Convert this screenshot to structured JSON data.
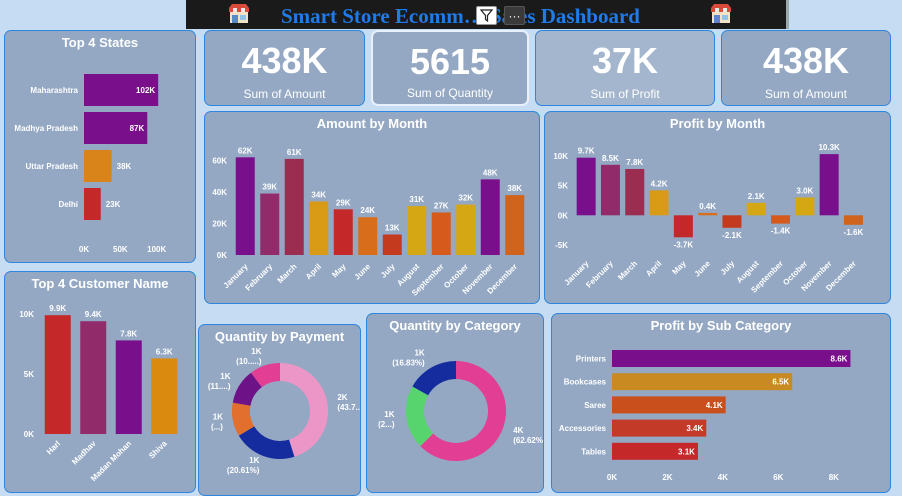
{
  "header": {
    "title": "Smart Store Ecomm… Sales Dashboard",
    "more_label": "···"
  },
  "kpis": [
    {
      "value": "438K",
      "label": "Sum of Amount"
    },
    {
      "value": "5615",
      "label": "Sum of Quantity"
    },
    {
      "value": "37K",
      "label": "Sum of Profit"
    },
    {
      "value": "438K",
      "label": "Sum of Amount"
    }
  ],
  "panels": {
    "states": "Top 4 States",
    "customers": "Top 4 Customer Name",
    "amount_month": "Amount by Month",
    "profit_month": "Profit by Month",
    "payment": "Quantity by Payment",
    "category": "Quantity by Category",
    "subcategory": "Profit by Sub Category"
  },
  "colors": {
    "purple": "#7a0f8c",
    "plum": "#922b6a",
    "wine": "#9a2d50",
    "mustard": "#d99a15",
    "red": "#c42828",
    "orange": "#d86e1c",
    "gold": "#d6a714",
    "pink": "#e23e94",
    "navy": "#142c9e",
    "green": "#58d46e"
  },
  "chart_data": [
    {
      "id": "states",
      "type": "bar",
      "orientation": "horizontal",
      "title": "Top 4 States",
      "categories": [
        "Maharashtra",
        "Madhya Pradesh",
        "Uttar Pradesh",
        "Delhi"
      ],
      "values": [
        102000,
        87000,
        38000,
        23000
      ],
      "labels": [
        "102K",
        "87K",
        "38K",
        "23K"
      ],
      "colors": [
        "#7a0f8c",
        "#7a0f8c",
        "#d9841b",
        "#c42828"
      ],
      "xticks": [
        "0K",
        "50K",
        "100K"
      ],
      "xlim": [
        0,
        110000
      ]
    },
    {
      "id": "customers",
      "type": "bar",
      "title": "Top 4 Customer Name",
      "categories": [
        "Harl",
        "Madhav",
        "Madan Mohan",
        "Shiva"
      ],
      "values": [
        9900,
        9400,
        7800,
        6300
      ],
      "labels": [
        "9.9K",
        "9.4K",
        "7.8K",
        "6.3K"
      ],
      "colors": [
        "#c42828",
        "#922b6a",
        "#7a0f8c",
        "#d98a0f"
      ],
      "yticks": [
        "0K",
        "5K",
        "10K"
      ],
      "ylim": [
        0,
        10000
      ]
    },
    {
      "id": "amount_month",
      "type": "bar",
      "title": "Amount by Month",
      "categories": [
        "January",
        "February",
        "March",
        "April",
        "May",
        "June",
        "July",
        "August",
        "September",
        "October",
        "November",
        "December"
      ],
      "values": [
        62000,
        39000,
        61000,
        34000,
        29000,
        24000,
        13000,
        31000,
        27000,
        32000,
        48000,
        38000
      ],
      "labels": [
        "62K",
        "39K",
        "61K",
        "34K",
        "29K",
        "24K",
        "13K",
        "31K",
        "27K",
        "32K",
        "48K",
        "38K"
      ],
      "colors": [
        "#7a0f8c",
        "#922b6a",
        "#9a2d50",
        "#d99a15",
        "#c42828",
        "#d86e1c",
        "#c43a1e",
        "#d6a714",
        "#d65a1c",
        "#d6a714",
        "#7a0f8c",
        "#d0641c"
      ],
      "yticks": [
        "0K",
        "20K",
        "40K",
        "60K"
      ],
      "ylim": [
        0,
        66000
      ]
    },
    {
      "id": "profit_month",
      "type": "bar",
      "title": "Profit by Month",
      "categories": [
        "January",
        "February",
        "March",
        "April",
        "May",
        "June",
        "July",
        "August",
        "September",
        "October",
        "November",
        "December"
      ],
      "values": [
        9700,
        8500,
        7800,
        4200,
        -3700,
        400,
        -2100,
        2100,
        -1400,
        3000,
        10300,
        -1600
      ],
      "labels": [
        "9.7K",
        "8.5K",
        "7.8K",
        "4.2K",
        "-3.7K",
        "0.4K",
        "-2.1K",
        "2.1K",
        "-1.4K",
        "3.0K",
        "10.3K",
        "-1.6K"
      ],
      "colors": [
        "#7a0f8c",
        "#922b6a",
        "#9a2d50",
        "#d99a15",
        "#c42828",
        "#d86e1c",
        "#c43a1e",
        "#d6a714",
        "#d65a1c",
        "#d6a714",
        "#7a0f8c",
        "#d0641c"
      ],
      "yticks": [
        "-5K",
        "0K",
        "5K",
        "10K"
      ],
      "ylim": [
        -5000,
        11500
      ]
    },
    {
      "id": "payment",
      "type": "pie",
      "title": "Quantity by Payment",
      "slices": [
        {
          "label": "2K (43.7...)",
          "value": 43.7,
          "color": "#ec96c8"
        },
        {
          "label": "1K (20.61%)",
          "value": 20.61,
          "color": "#142c9e"
        },
        {
          "label": "1K (...)",
          "value": 11,
          "color": "#e26f2e"
        },
        {
          "label": "1K (11....)",
          "value": 11.5,
          "color": "#6e1288"
        },
        {
          "label": "1K (10.....)",
          "value": 10,
          "color": "#e23e94"
        }
      ]
    },
    {
      "id": "category",
      "type": "pie",
      "title": "Quantity by Category",
      "slices": [
        {
          "label": "4K (62.62%)",
          "value": 62.62,
          "color": "#e23e94"
        },
        {
          "label": "1K (2...)",
          "value": 20.55,
          "color": "#58d46e"
        },
        {
          "label": "1K (16.83%)",
          "value": 16.83,
          "color": "#142c9e"
        }
      ]
    },
    {
      "id": "subcategory",
      "type": "bar",
      "orientation": "horizontal",
      "title": "Profit by Sub Category",
      "categories": [
        "Printers",
        "Bookcases",
        "Saree",
        "Accessories",
        "Tables"
      ],
      "values": [
        8600,
        6500,
        4100,
        3400,
        3100
      ],
      "labels": [
        "8.6K",
        "6.5K",
        "4.1K",
        "3.4K",
        "3.1K"
      ],
      "colors": [
        "#7a0f8c",
        "#c98a22",
        "#c9501c",
        "#c43a28",
        "#c42828"
      ],
      "xticks": [
        "0K",
        "2K",
        "4K",
        "6K",
        "8K"
      ],
      "xlim": [
        0,
        8800
      ]
    }
  ]
}
